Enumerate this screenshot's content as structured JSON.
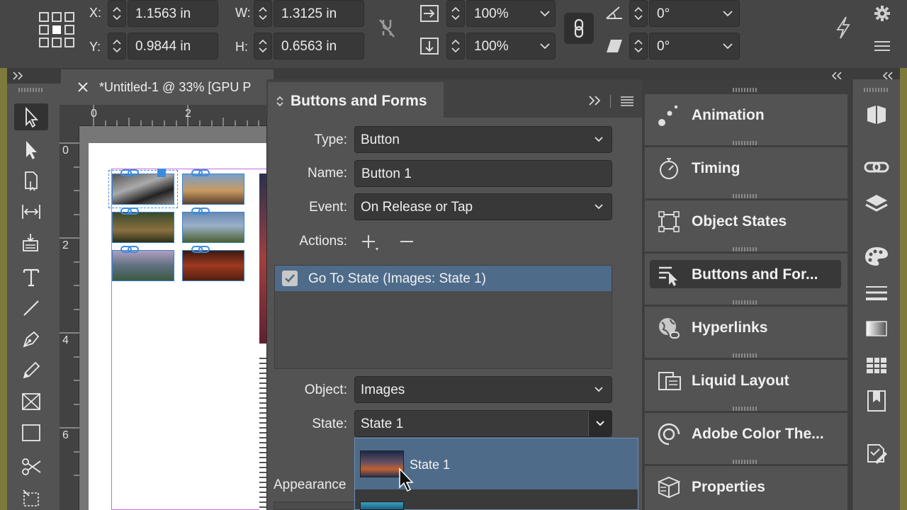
{
  "control_bar": {
    "x_label": "X:",
    "x_value": "1.1563 in",
    "y_label": "Y:",
    "y_value": "0.9844 in",
    "w_label": "W:",
    "w_value": "1.3125 in",
    "h_label": "H:",
    "h_value": "0.6563 in",
    "scale_x": "100%",
    "scale_y": "100%",
    "rotation": "0°",
    "shear": "0°"
  },
  "document": {
    "tab_title": "*Untitled-1 @ 33% [GPU P",
    "ruler_h": [
      "0",
      "2"
    ],
    "ruler_v": [
      "0",
      "2",
      "4",
      "6"
    ]
  },
  "buttons_forms": {
    "title": "Buttons and Forms",
    "type_label": "Type:",
    "type_value": "Button",
    "name_label": "Name:",
    "name_value": "Button 1",
    "event_label": "Event:",
    "event_value": "On Release or Tap",
    "actions_label": "Actions:",
    "action_item": "Go To State (Images: State 1)",
    "object_label": "Object:",
    "object_value": "Images",
    "state_label": "State:",
    "state_value": "State 1",
    "appearance_label": "Appearance",
    "dropdown_options": [
      "State 1"
    ]
  },
  "dock": {
    "items": [
      {
        "label": "Animation",
        "icon": "animation-icon"
      },
      {
        "label": "Timing",
        "icon": "timing-icon"
      },
      {
        "label": "Object States",
        "icon": "object-states-icon"
      },
      {
        "label": "Buttons and For...",
        "icon": "buttons-forms-icon"
      },
      {
        "label": "Hyperlinks",
        "icon": "hyperlinks-icon"
      },
      {
        "label": "Liquid Layout",
        "icon": "liquid-layout-icon"
      },
      {
        "label": "Adobe Color The...",
        "icon": "adobe-color-icon"
      },
      {
        "label": "Properties",
        "icon": "properties-icon"
      }
    ]
  },
  "colors": {
    "panel_bg": "#535353",
    "selection": "#4e6b8a",
    "accent_border": "#6b8fb8",
    "chrome_edge": "#7d7a3b"
  }
}
